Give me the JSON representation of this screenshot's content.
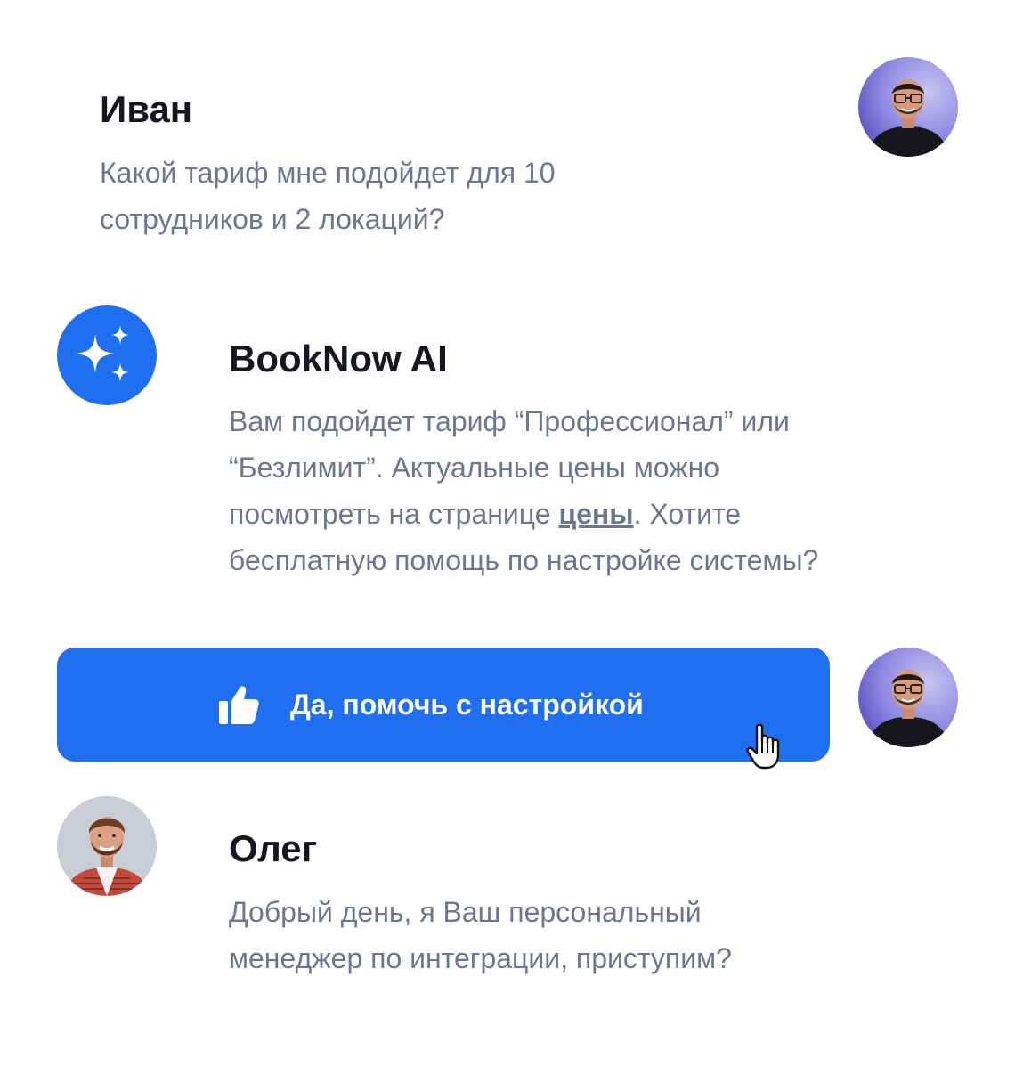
{
  "messages": {
    "ivan": {
      "name": "Иван",
      "line1": "Какой тариф мне подойдет для 10",
      "line2": "сотрудников и 2 локаций?"
    },
    "ai": {
      "name": "BookNow AI",
      "line1": "Вам подойдет тариф “Профессионал” или",
      "line2": "“Безлимит”. Актуальные цены можно",
      "line3_before": "посмотреть на странице ",
      "line3_link": "цены",
      "line3_after": ". Хотите",
      "line4": "бесплатную помощь по настройке системы?"
    },
    "oleg": {
      "name": "Олег",
      "line1": "Добрый день, я Ваш персональный",
      "line2": "менеджер по интеграции, приступим?"
    }
  },
  "action": {
    "label": "Да, помочь с настройкой",
    "icon": "thumbs-up-icon"
  },
  "colors": {
    "accent": "#1f6ff0",
    "name_text": "#14171f",
    "message_text": "#6b7791"
  }
}
